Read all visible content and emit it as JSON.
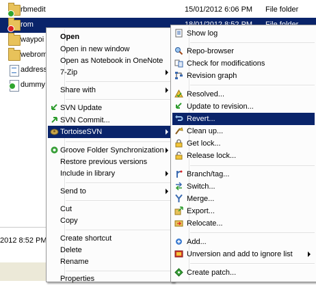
{
  "files": [
    {
      "name": "rbmedit",
      "date": "15/01/2012 6:06 PM",
      "type": "File folder"
    },
    {
      "name": "rom",
      "date": "18/01/2012 8:52 PM",
      "type": "File folder"
    },
    {
      "name": "waypoi"
    },
    {
      "name": "webrom"
    },
    {
      "name": "address"
    },
    {
      "name": "dummy"
    }
  ],
  "details": {
    "date": "2012 8:52 PM"
  },
  "context_menu": {
    "open": "Open",
    "open_new_window": "Open in new window",
    "open_onenote": "Open as Notebook in OneNote",
    "sevenzip": "7-Zip",
    "share_with": "Share with",
    "svn_update": "SVN Update",
    "svn_commit": "SVN Commit...",
    "tortoisesvn": "TortoiseSVN",
    "groove_sync": "Groove Folder Synchronization",
    "restore_versions": "Restore previous versions",
    "include_library": "Include in library",
    "send_to": "Send to",
    "cut": "Cut",
    "copy": "Copy",
    "create_shortcut": "Create shortcut",
    "delete": "Delete",
    "rename": "Rename",
    "properties": "Properties"
  },
  "svn_menu": {
    "show_log": "Show log",
    "repo_browser": "Repo-browser",
    "check_mods": "Check for modifications",
    "revision_graph": "Revision graph",
    "resolved": "Resolved...",
    "update_revision": "Update to revision...",
    "revert": "Revert...",
    "clean_up": "Clean up...",
    "get_lock": "Get lock...",
    "release_lock": "Release lock...",
    "branch_tag": "Branch/tag...",
    "switch": "Switch...",
    "merge": "Merge...",
    "export": "Export...",
    "relocate": "Relocate...",
    "add": "Add...",
    "unversion_ignore": "Unversion and add to ignore list",
    "create_patch": "Create patch..."
  },
  "colors": {
    "selection": "#0a246a",
    "menu_bg": "#fcfcfc"
  }
}
